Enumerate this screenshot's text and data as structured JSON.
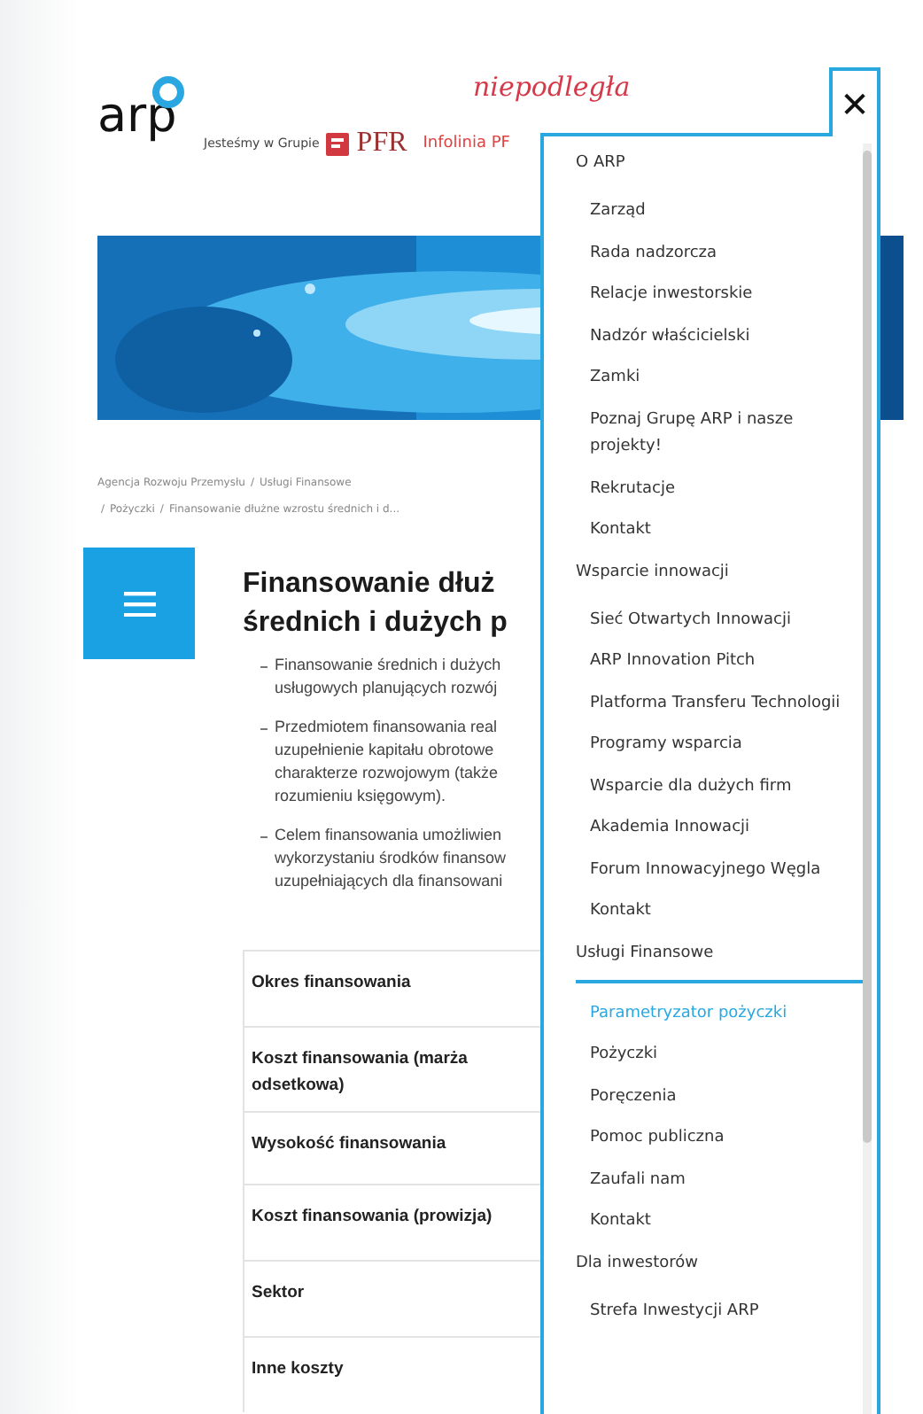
{
  "header": {
    "logo_text": "arp",
    "script_title": "niepodległa",
    "group_label": "Jesteśmy w Grupie",
    "group_logo_text": "PFR",
    "hotline": "Infolinia PF"
  },
  "breadcrumb": {
    "lines": [
      [
        "Agencja Rozwoju Przemysłu",
        "/",
        "Usługi Finansowe"
      ],
      [
        "/",
        "Pożyczki",
        "/",
        "Finansowanie dłużne wzrostu średnich i d..."
      ]
    ]
  },
  "article": {
    "title_lines": [
      "Finansowanie dłuż",
      "średnich i dużych p"
    ],
    "bullets": [
      {
        "lines": [
          "Finansowanie średnich i dużych",
          "usługowych planujących rozwój"
        ]
      },
      {
        "lines": [
          "Przedmiotem finansowania real",
          "uzupełnienie kapitału obrotowe",
          "charakterze rozwojowym (także",
          "rozumieniu księgowym)."
        ]
      },
      {
        "lines": [
          "Celem finansowania umożliwien",
          "wykorzystaniu środków finansow",
          "uzupełniających dla finansowani"
        ]
      }
    ],
    "table_rows": [
      [
        "Okres finansowania"
      ],
      [
        "Koszt finansowania (marża",
        "odsetkowa)"
      ],
      [
        "Wysokość finansowania"
      ],
      [
        "Koszt finansowania (prowizja)"
      ],
      [
        "Sektor"
      ],
      [
        "Inne koszty"
      ]
    ]
  },
  "menu": {
    "close": "✕",
    "sections": [
      {
        "label": "O ARP",
        "active": false,
        "children": [
          {
            "label": "Zarząd",
            "selected": false
          },
          {
            "label": "Rada nadzorcza",
            "selected": false
          },
          {
            "label": "Relacje inwestorskie",
            "selected": false
          },
          {
            "label": "Nadzór właścicielski",
            "selected": false
          },
          {
            "label": "Zamki",
            "selected": false
          },
          {
            "label": "Poznaj Grupę ARP i nasze projekty!",
            "selected": false
          },
          {
            "label": "Rekrutacje",
            "selected": false
          },
          {
            "label": "Kontakt",
            "selected": false
          }
        ]
      },
      {
        "label": "Wsparcie innowacji",
        "active": false,
        "children": [
          {
            "label": "Sieć Otwartych Innowacji",
            "selected": false
          },
          {
            "label": "ARP Innovation Pitch",
            "selected": false
          },
          {
            "label": "Platforma Transferu Technologii",
            "selected": false
          },
          {
            "label": "Programy wsparcia",
            "selected": false
          },
          {
            "label": "Wsparcie dla dużych firm",
            "selected": false
          },
          {
            "label": "Akademia Innowacji",
            "selected": false
          },
          {
            "label": "Forum Innowacyjnego Węgla",
            "selected": false
          },
          {
            "label": "Kontakt",
            "selected": false
          }
        ]
      },
      {
        "label": "Usługi Finansowe",
        "active": true,
        "children": [
          {
            "label": "Parametryzator pożyczki",
            "selected": true
          },
          {
            "label": "Pożyczki",
            "selected": false
          },
          {
            "label": "Poręczenia",
            "selected": false
          },
          {
            "label": "Pomoc publiczna",
            "selected": false
          },
          {
            "label": "Zaufali nam",
            "selected": false
          },
          {
            "label": "Kontakt",
            "selected": false
          }
        ]
      },
      {
        "label": "Dla inwestorów",
        "active": false,
        "children": [
          {
            "label": "Strefa Inwestycji ARP",
            "selected": false
          }
        ]
      }
    ]
  }
}
